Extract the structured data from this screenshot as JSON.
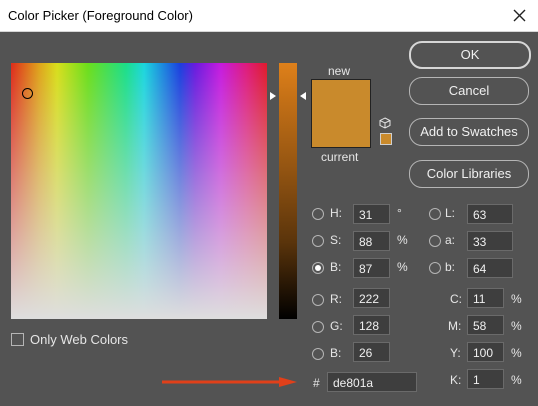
{
  "window": {
    "title": "Color Picker (Foreground Color)"
  },
  "swatches": {
    "new_label": "new",
    "current_label": "current",
    "color_hex": "#c98a2c",
    "current_hex": "#c98a2c"
  },
  "buttons": {
    "ok": "OK",
    "cancel": "Cancel",
    "add": "Add to Swatches",
    "libraries": "Color Libraries"
  },
  "hsb": [
    {
      "label": "H:",
      "value": "31",
      "unit": "°",
      "selected": false
    },
    {
      "label": "S:",
      "value": "88",
      "unit": "%",
      "selected": false
    },
    {
      "label": "B:",
      "value": "87",
      "unit": "%",
      "selected": true
    }
  ],
  "lab": [
    {
      "label": "L:",
      "value": "63"
    },
    {
      "label": "a:",
      "value": "33"
    },
    {
      "label": "b:",
      "value": "64"
    }
  ],
  "rgb": [
    {
      "label": "R:",
      "value": "222"
    },
    {
      "label": "G:",
      "value": "128"
    },
    {
      "label": "B:",
      "value": "26"
    }
  ],
  "cmyk": [
    {
      "label": "C:",
      "value": "11",
      "unit": "%"
    },
    {
      "label": "M:",
      "value": "58",
      "unit": "%"
    },
    {
      "label": "Y:",
      "value": "100",
      "unit": "%"
    },
    {
      "label": "K:",
      "value": "1",
      "unit": "%"
    }
  ],
  "hex": {
    "hash": "#",
    "value": "de801a"
  },
  "web_only": {
    "label": "Only Web Colors",
    "checked": false
  },
  "colors": {
    "arrow": "#e0401a",
    "dialog_bg": "#535353"
  }
}
